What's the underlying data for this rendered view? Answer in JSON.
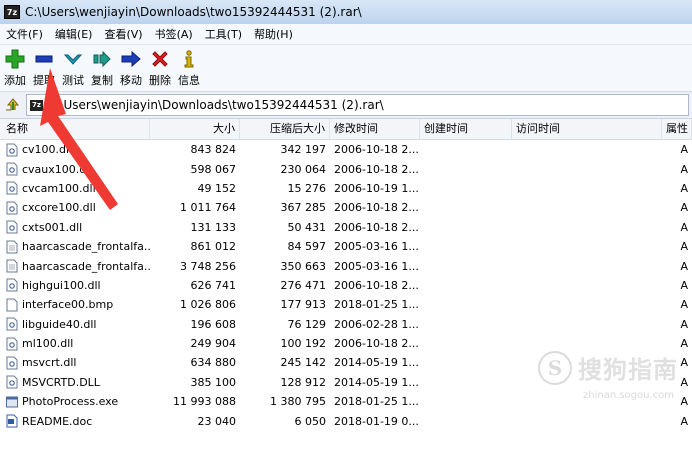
{
  "window": {
    "title": "C:\\Users\\wenjiayin\\Downloads\\two15392444531 (2).rar\\",
    "app_icon_text": "7z"
  },
  "menu": [
    {
      "label": "文件(F)"
    },
    {
      "label": "编辑(E)"
    },
    {
      "label": "查看(V)"
    },
    {
      "label": "书签(A)"
    },
    {
      "label": "工具(T)"
    },
    {
      "label": "帮助(H)"
    }
  ],
  "toolbar": {
    "buttons": [
      {
        "label": "添加",
        "icon": "add-icon",
        "color": "#2aa52a"
      },
      {
        "label": "提取",
        "icon": "extract-icon",
        "color": "#1c3fb8"
      },
      {
        "label": "测试",
        "icon": "test-icon",
        "color": "#1f9bb5"
      },
      {
        "label": "复制",
        "icon": "copy-icon",
        "color": "#1f9b8a"
      },
      {
        "label": "移动",
        "icon": "move-icon",
        "color": "#1c3fb8"
      },
      {
        "label": "删除",
        "icon": "delete-icon",
        "color": "#e02020"
      },
      {
        "label": "信息",
        "icon": "info-icon",
        "color": "#d6b400"
      }
    ]
  },
  "address": {
    "path": "C:\\Users\\wenjiayin\\Downloads\\two15392444531 (2).rar\\",
    "icon_text": "7z"
  },
  "columns": {
    "name": "名称",
    "size": "大小",
    "packed": "压缩后大小",
    "modified": "修改时间",
    "created": "创建时间",
    "accessed": "访问时间",
    "attr": "属性"
  },
  "files": [
    {
      "name": "cv100.dll",
      "size": "843 824",
      "packed": "342 197",
      "modified": "2006-10-18 2...",
      "attr": "A",
      "type": "dll"
    },
    {
      "name": "cvaux100.dll",
      "size": "598 067",
      "packed": "230 064",
      "modified": "2006-10-18 2...",
      "attr": "A",
      "type": "dll"
    },
    {
      "name": "cvcam100.dll",
      "size": "49 152",
      "packed": "15 276",
      "modified": "2006-10-19 1...",
      "attr": "A",
      "type": "dll"
    },
    {
      "name": "cxcore100.dll",
      "size": "1 011 764",
      "packed": "367 285",
      "modified": "2006-10-18 2...",
      "attr": "A",
      "type": "dll"
    },
    {
      "name": "cxts001.dll",
      "size": "131 133",
      "packed": "50 431",
      "modified": "2006-10-18 2...",
      "attr": "A",
      "type": "dll"
    },
    {
      "name": "haarcascade_frontalfa...",
      "size": "861 012",
      "packed": "84 597",
      "modified": "2005-03-16 1...",
      "attr": "A",
      "type": "doc"
    },
    {
      "name": "haarcascade_frontalfa...",
      "size": "3 748 256",
      "packed": "350 663",
      "modified": "2005-03-16 1...",
      "attr": "A",
      "type": "doc"
    },
    {
      "name": "highgui100.dll",
      "size": "626 741",
      "packed": "276 471",
      "modified": "2006-10-18 2...",
      "attr": "A",
      "type": "dll"
    },
    {
      "name": "interface00.bmp",
      "size": "1 026 806",
      "packed": "177 913",
      "modified": "2018-01-25 1...",
      "attr": "A",
      "type": "blank"
    },
    {
      "name": "libguide40.dll",
      "size": "196 608",
      "packed": "76 129",
      "modified": "2006-02-28 1...",
      "attr": "A",
      "type": "dll"
    },
    {
      "name": "ml100.dll",
      "size": "249 904",
      "packed": "100 192",
      "modified": "2006-10-18 2...",
      "attr": "A",
      "type": "dll"
    },
    {
      "name": "msvcrt.dll",
      "size": "634 880",
      "packed": "245 142",
      "modified": "2014-05-19 1...",
      "attr": "A",
      "type": "dll"
    },
    {
      "name": "MSVCRTD.DLL",
      "size": "385 100",
      "packed": "128 912",
      "modified": "2014-05-19 1...",
      "attr": "A",
      "type": "dll"
    },
    {
      "name": "PhotoProcess.exe",
      "size": "11 993 088",
      "packed": "1 380 795",
      "modified": "2018-01-25 1...",
      "attr": "A",
      "type": "exe"
    },
    {
      "name": "README.doc",
      "size": "23 040",
      "packed": "6 050",
      "modified": "2018-01-19 0...",
      "attr": "A",
      "type": "worddoc"
    }
  ],
  "watermark": {
    "logo_letter": "S",
    "text": "搜狗指南",
    "url": "zhinan.sogou.com"
  }
}
